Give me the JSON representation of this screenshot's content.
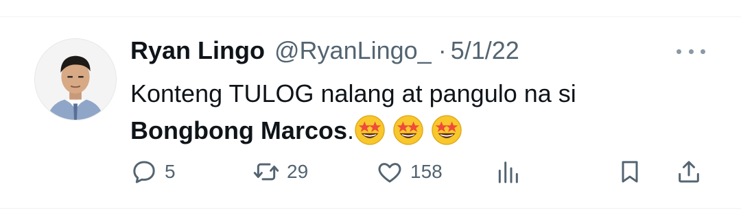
{
  "tweet": {
    "author": {
      "name": "Ryan Lingo",
      "handle": "@RyanLingo_",
      "separator": "·",
      "date": "5/1/22"
    },
    "text_line1": "Konteng TULOG nalang at pangulo na si",
    "text_bold": "Bongbong Marcos",
    "text_period": ".",
    "emojis": [
      "star-struck-emoji",
      "star-struck-emoji",
      "star-struck-emoji"
    ],
    "metrics": {
      "replies": "5",
      "retweets": "29",
      "likes": "158"
    }
  },
  "colors": {
    "text": "#0f1419",
    "secondary": "#536471",
    "divider": "#eff3f4"
  }
}
